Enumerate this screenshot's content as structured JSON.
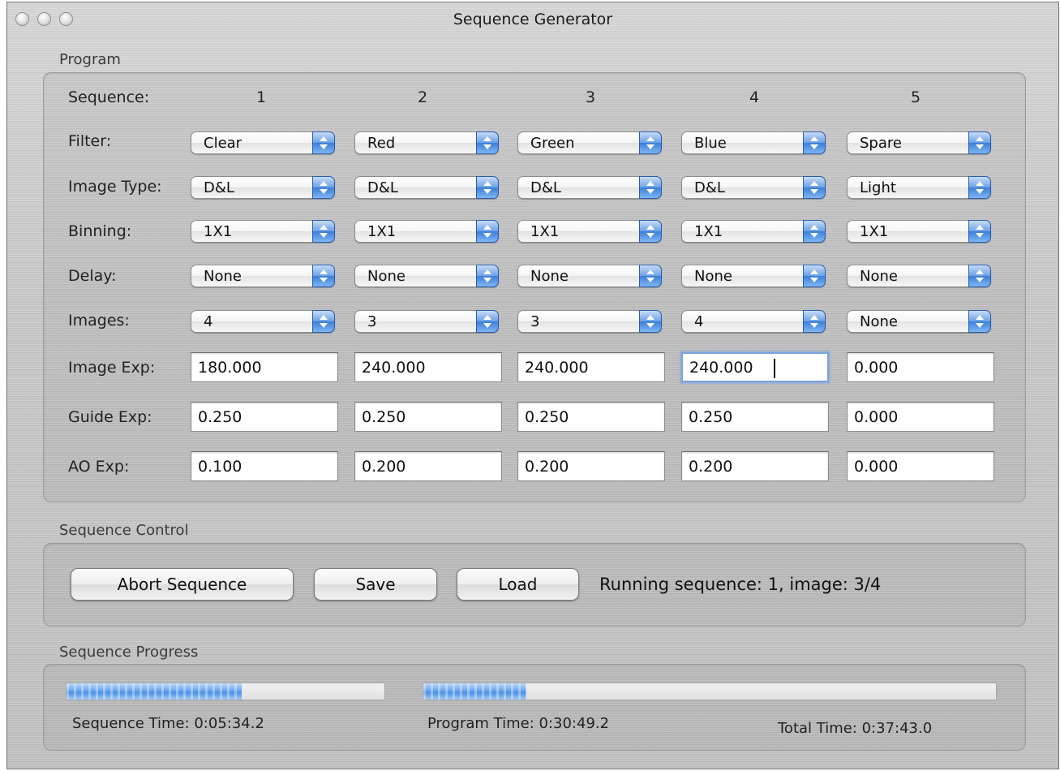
{
  "window": {
    "title": "Sequence Generator"
  },
  "program": {
    "group_label": "Program",
    "header_label": "Sequence:",
    "columns": [
      "1",
      "2",
      "3",
      "4",
      "5"
    ],
    "row_labels": {
      "filter": "Filter:",
      "image_type": "Image Type:",
      "binning": "Binning:",
      "delay": "Delay:",
      "images": "Images:",
      "image_exp": "Image Exp:",
      "guide_exp": "Guide Exp:",
      "ao_exp": "AO Exp:"
    },
    "filter": [
      "Clear",
      "Red",
      "Green",
      "Blue",
      "Spare"
    ],
    "image_type": [
      "D&L",
      "D&L",
      "D&L",
      "D&L",
      "Light"
    ],
    "binning": [
      "1X1",
      "1X1",
      "1X1",
      "1X1",
      "1X1"
    ],
    "delay": [
      "None",
      "None",
      "None",
      "None",
      "None"
    ],
    "images": [
      "4",
      "3",
      "3",
      "4",
      "None"
    ],
    "image_exp": [
      "180.000",
      "240.000",
      "240.000",
      "240.000",
      "0.000"
    ],
    "guide_exp": [
      "0.250",
      "0.250",
      "0.250",
      "0.250",
      "0.000"
    ],
    "ao_exp": [
      "0.100",
      "0.200",
      "0.200",
      "0.200",
      "0.000"
    ]
  },
  "control": {
    "group_label": "Sequence Control",
    "abort_label": "Abort Sequence",
    "save_label": "Save",
    "load_label": "Load",
    "status_text": "Running sequence: 1, image: 3/4"
  },
  "progress": {
    "group_label": "Sequence Progress",
    "sequence_fraction": 0.55,
    "program_fraction": 0.18,
    "sequence_time": "Sequence Time: 0:05:34.2",
    "program_time": "Program Time: 0:30:49.2",
    "total_time": "Total Time: 0:37:43.0"
  },
  "colors": {
    "accent": "#3a7ed8",
    "progress_fill": "#5b9be9"
  },
  "icons": [
    "window-close-icon",
    "window-minimize-icon",
    "window-zoom-icon",
    "popup-arrows-icon"
  ]
}
